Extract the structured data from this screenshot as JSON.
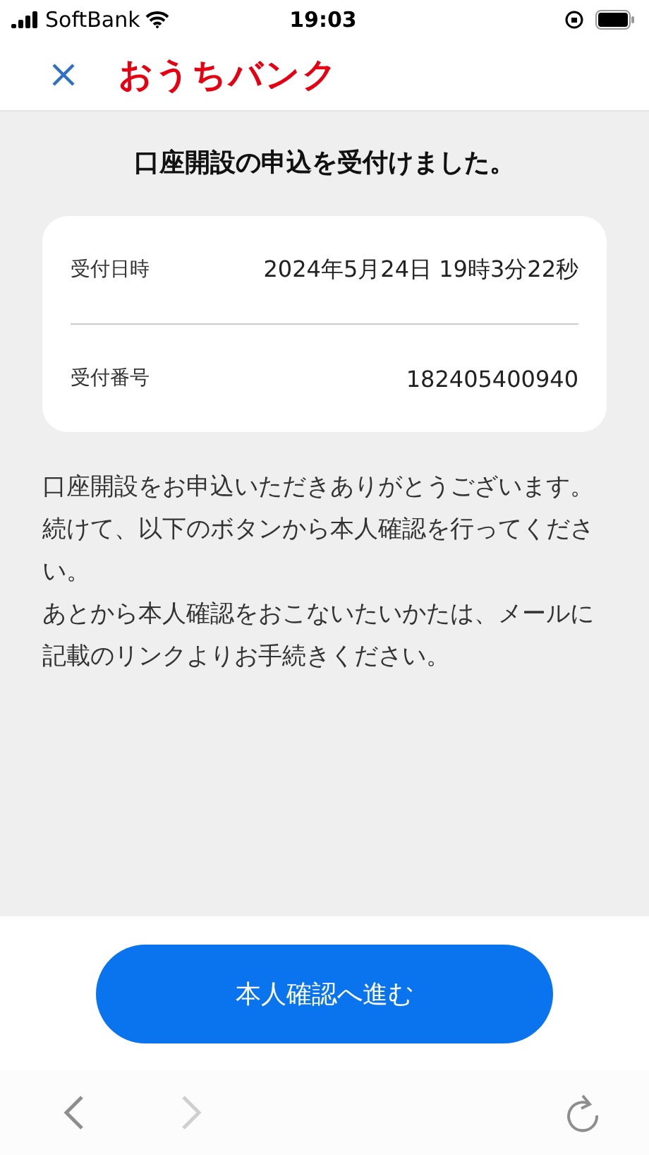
{
  "status_bar": {
    "carrier": "SoftBank",
    "time": "19:03"
  },
  "header": {
    "brand": "おうちバンク"
  },
  "title": "口座開設の申込を受付けました。",
  "details": [
    {
      "label": "受付日時",
      "value": "2024年5月24日 19時3分22秒"
    },
    {
      "label": "受付番号",
      "value": "182405400940"
    }
  ],
  "message": [
    "口座開設をお申込いただきありがとうございます。",
    "続けて、以下のボタンから本人確認を行ってください。",
    "あとから本人確認をおこないたいかたは、メールに記載のリンクよりお手続きください。"
  ],
  "primary_button": "本人確認へ進む",
  "browser_toolbar": {
    "back": {
      "disabled": false
    },
    "forward": {
      "disabled": true
    }
  }
}
